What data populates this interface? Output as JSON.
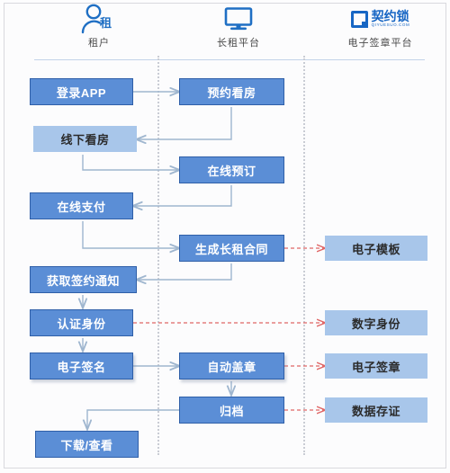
{
  "lanes": [
    {
      "id": "tenant",
      "label": "租户",
      "icon": "person-rent-icon",
      "icon_char": "租"
    },
    {
      "id": "platform",
      "label": "长租平台",
      "icon": "monitor-icon"
    },
    {
      "id": "esign",
      "label": "电子签章平台",
      "icon": "qiyuesuo-logo-icon",
      "brand": "契约锁",
      "brand_sub": "QIYUESUO.COM"
    }
  ],
  "colors": {
    "box_dark_fill": "#5b8ed6",
    "box_dark_border": "#2f5fa8",
    "box_light_fill": "#a8c6ea",
    "connector": "#9fb6cf",
    "dashed_connector": "#e06666",
    "lane_divider": "#c9ccd4",
    "header_rule": "#c3d3e8"
  },
  "nodes": [
    {
      "id": "login-app",
      "label": "登录APP",
      "lane": "tenant",
      "style": "dark"
    },
    {
      "id": "book-viewing",
      "label": "预约看房",
      "lane": "platform",
      "style": "dark"
    },
    {
      "id": "offline-viewing",
      "label": "线下看房",
      "lane": "tenant",
      "style": "light"
    },
    {
      "id": "online-booking",
      "label": "在线预订",
      "lane": "platform",
      "style": "dark"
    },
    {
      "id": "online-payment",
      "label": "在线支付",
      "lane": "tenant",
      "style": "dark"
    },
    {
      "id": "generate-contract",
      "label": "生成长租合同",
      "lane": "platform",
      "style": "dark"
    },
    {
      "id": "e-template",
      "label": "电子模板",
      "lane": "esign",
      "style": "light"
    },
    {
      "id": "sign-notice",
      "label": "获取签约通知",
      "lane": "tenant",
      "style": "dark"
    },
    {
      "id": "verify-identity",
      "label": "认证身份",
      "lane": "tenant",
      "style": "dark"
    },
    {
      "id": "digital-identity",
      "label": "数字身份",
      "lane": "esign",
      "style": "light"
    },
    {
      "id": "e-signature",
      "label": "电子签名",
      "lane": "tenant",
      "style": "dark"
    },
    {
      "id": "auto-stamp",
      "label": "自动盖章",
      "lane": "platform",
      "style": "dark"
    },
    {
      "id": "e-seal",
      "label": "电子签章",
      "lane": "esign",
      "style": "light"
    },
    {
      "id": "archive",
      "label": "归档",
      "lane": "platform",
      "style": "dark"
    },
    {
      "id": "data-evidence",
      "label": "数据存证",
      "lane": "esign",
      "style": "light"
    },
    {
      "id": "download-view",
      "label": "下载/查看",
      "lane": "tenant",
      "style": "dark"
    }
  ],
  "edges": [
    {
      "from": "login-app",
      "to": "book-viewing",
      "kind": "solid"
    },
    {
      "from": "book-viewing",
      "to": "offline-viewing",
      "kind": "solid"
    },
    {
      "from": "offline-viewing",
      "to": "online-booking",
      "kind": "solid"
    },
    {
      "from": "online-booking",
      "to": "online-payment",
      "kind": "solid"
    },
    {
      "from": "online-payment",
      "to": "generate-contract",
      "kind": "solid"
    },
    {
      "from": "generate-contract",
      "to": "e-template",
      "kind": "dashed"
    },
    {
      "from": "generate-contract",
      "to": "sign-notice",
      "kind": "solid"
    },
    {
      "from": "sign-notice",
      "to": "verify-identity",
      "kind": "solid"
    },
    {
      "from": "verify-identity",
      "to": "digital-identity",
      "kind": "dashed"
    },
    {
      "from": "verify-identity",
      "to": "e-signature",
      "kind": "solid"
    },
    {
      "from": "e-signature",
      "to": "auto-stamp",
      "kind": "solid"
    },
    {
      "from": "auto-stamp",
      "to": "e-seal",
      "kind": "dashed"
    },
    {
      "from": "auto-stamp",
      "to": "archive",
      "kind": "solid"
    },
    {
      "from": "archive",
      "to": "data-evidence",
      "kind": "dashed"
    },
    {
      "from": "archive",
      "to": "download-view",
      "kind": "solid"
    }
  ]
}
